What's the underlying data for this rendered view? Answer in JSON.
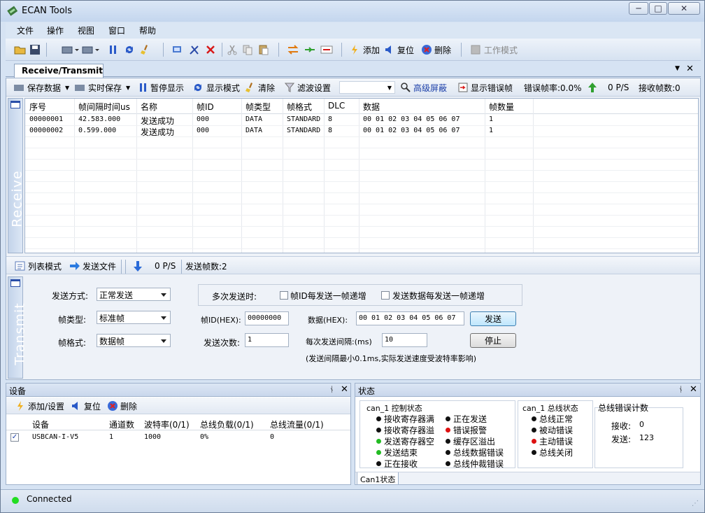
{
  "window": {
    "title": "ECAN Tools",
    "minimize": "─",
    "maximize": "□",
    "close": "✕"
  },
  "menu": [
    "文件",
    "操作",
    "视图",
    "窗口",
    "帮助"
  ],
  "toolbar": {
    "add": "添加",
    "reset": "复位",
    "delete": "删除",
    "work_mode": "工作模式"
  },
  "doc_tabs": {
    "active": "Receive/Transmit",
    "dropdown": "▼",
    "close": "✕"
  },
  "receive_bar": {
    "save_data": "保存数据",
    "realtime_save": "实时保存",
    "pause": "暂停显示",
    "display_mode": "显示模式",
    "clear": "清除",
    "filter": "滤波设置",
    "adv_mask": "高级屏蔽",
    "show_error": "显示错误帧",
    "error_rate": "错误帧率:0.0%",
    "rate": "0 P/S",
    "recv_count": "接收帧数:0"
  },
  "side_labels": {
    "receive": "Receive",
    "transmit": "Transmit"
  },
  "grid": {
    "columns": [
      "序号",
      "帧间隔时间us",
      "名称",
      "帧ID",
      "帧类型",
      "帧格式",
      "DLC",
      "数据",
      "帧数量"
    ],
    "rows": [
      [
        "00000001",
        "42.583.000",
        "发送成功",
        "000",
        "DATA",
        "STANDARD",
        "8",
        "00 01 02 03 04 05 06 07",
        "1"
      ],
      [
        "00000002",
        "0.599.000",
        "发送成功",
        "000",
        "DATA",
        "STANDARD",
        "8",
        "00 01 02 03 04 05 06 07",
        "1"
      ]
    ]
  },
  "transmit_bar": {
    "list_mode": "列表模式",
    "send_file": "发送文件",
    "rate": "0 P/S",
    "sent_count": "发送帧数:2"
  },
  "transmit": {
    "send_mode_label": "发送方式:",
    "send_mode": "正常发送",
    "frame_type_label": "帧类型:",
    "frame_type": "标准帧",
    "frame_format_label": "帧格式:",
    "frame_format": "数据帧",
    "multi_label": "多次发送时:",
    "id_inc": "帧ID每发送一帧递增",
    "data_inc": "发送数据每发送一帧递增",
    "frame_id_label": "帧ID(HEX):",
    "frame_id": "00000000",
    "data_label": "数据(HEX):",
    "data": "00 01 02 03 04 05 06 07",
    "send_btn": "发送",
    "count_label": "发送次数:",
    "count": "1",
    "interval_label": "每次发送间隔:(ms)",
    "interval": "10",
    "stop_btn": "停止",
    "note": "(发送间隔最小0.1ms,实际发送速度受波特率影响)"
  },
  "device_panel": {
    "title": "设备",
    "pin": "ᚾ",
    "close": "✕",
    "add": "添加/设置",
    "reset": "复位",
    "delete": "删除",
    "columns": [
      "设备",
      "通道数",
      "波特率(0/1)",
      "总线负载(0/1)",
      "总线流量(0/1)"
    ],
    "row": [
      "USBCAN-I-V5",
      "1",
      "1000",
      "0%",
      "0"
    ],
    "checked": "✓"
  },
  "status_panel": {
    "title": "状态",
    "pin": "ᚾ",
    "close": "✕",
    "ctrl_title": "can_1 控制状态",
    "ctrl_left": [
      "接收寄存器满",
      "接收寄存器溢",
      "发送寄存器空",
      "发送结束",
      "正在接收"
    ],
    "ctrl_right": [
      "正在发送",
      "错误报警",
      "缓存区溢出",
      "总线数据错误",
      "总线仲裁错误"
    ],
    "bus_title": "can_1 总线状态",
    "bus_items": [
      "总线正常",
      "被动错误",
      "主动错误",
      "总线关闭"
    ],
    "err_title": "总线错误计数",
    "recv_label": "接收:",
    "recv_val": "0",
    "send_label": "发送:",
    "send_val": "123",
    "tab": "Can1状态",
    "colors": {
      "black": "#111111",
      "green": "#22bb22",
      "red": "#dd1111"
    }
  },
  "statusbar": {
    "text": "Connected",
    "led_color": "#22dd22"
  }
}
